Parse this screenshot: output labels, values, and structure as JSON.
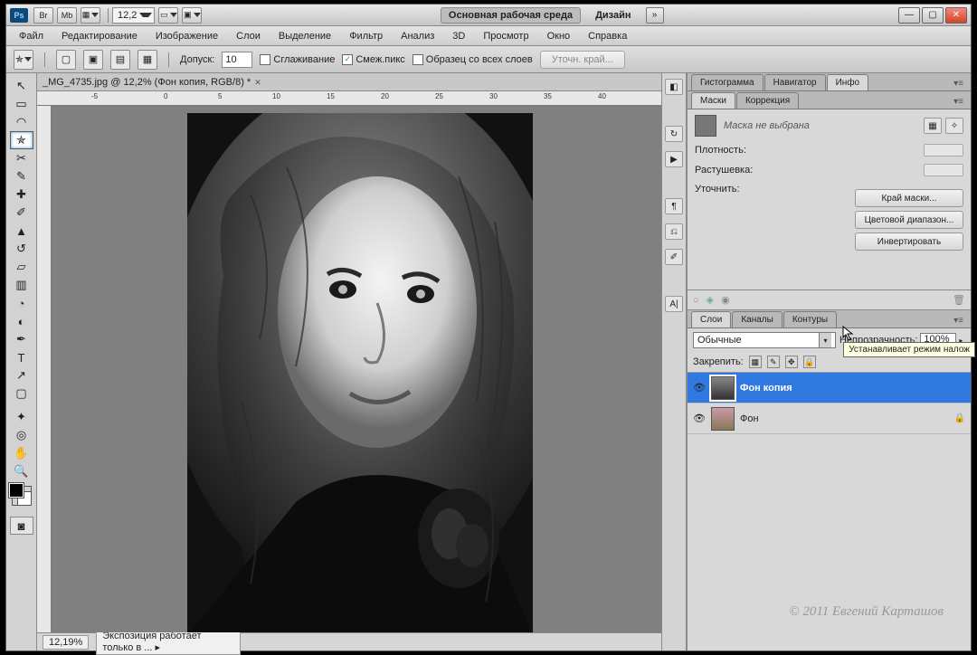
{
  "titlebar": {
    "zoom": "12,2",
    "workspace_active": "Основная рабочая среда",
    "workspace_other": "Дизайн"
  },
  "menu": [
    "Файл",
    "Редактирование",
    "Изображение",
    "Слои",
    "Выделение",
    "Фильтр",
    "Анализ",
    "3D",
    "Просмотр",
    "Окно",
    "Справка"
  ],
  "options": {
    "tolerance_label": "Допуск:",
    "tolerance_value": "10",
    "antialias": "Сглаживание",
    "contiguous": "Смеж.пикс",
    "sample_all": "Образец со всех слоев",
    "refine": "Уточн. край..."
  },
  "document": {
    "tab": "_MG_4735.jpg @ 12,2% (Фон копия, RGB/8) *"
  },
  "status": {
    "zoom": "12,19%",
    "msg": "Экспозиция работает только в ..."
  },
  "panels1": {
    "tabs": [
      "Гистограмма",
      "Навигатор",
      "Инфо"
    ],
    "active": 2
  },
  "masks": {
    "tabs": [
      "Маски",
      "Коррекция"
    ],
    "active": 0,
    "none": "Маска не выбрана",
    "density": "Плотность:",
    "feather": "Растушевка:",
    "refine": "Уточнить:",
    "btn_edge": "Край маски...",
    "btn_range": "Цветовой диапазон...",
    "btn_invert": "Инвертировать"
  },
  "layers": {
    "tabs": [
      "Слои",
      "Каналы",
      "Контуры"
    ],
    "active": 0,
    "blend": "Обычные",
    "opacity_label": "Непрозрачность:",
    "opacity_value": "100%",
    "lock_label": "Закрепить:",
    "items": [
      {
        "name": "Фон копия",
        "selected": true,
        "locked": false
      },
      {
        "name": "Фон",
        "selected": false,
        "locked": true
      }
    ]
  },
  "tooltip": "Устанавливает режим налож",
  "watermark": "© 2011 Евгений Карташов",
  "tool_icons": [
    "↖",
    "▭",
    "◌",
    "✄",
    "✎",
    "✐",
    "⌕",
    "◐",
    "✦",
    "⌧",
    "▤",
    "◢",
    "●",
    "▲",
    "✥",
    "◉",
    "✎",
    "T",
    "↗",
    "⬚",
    "✋",
    "🔍"
  ]
}
